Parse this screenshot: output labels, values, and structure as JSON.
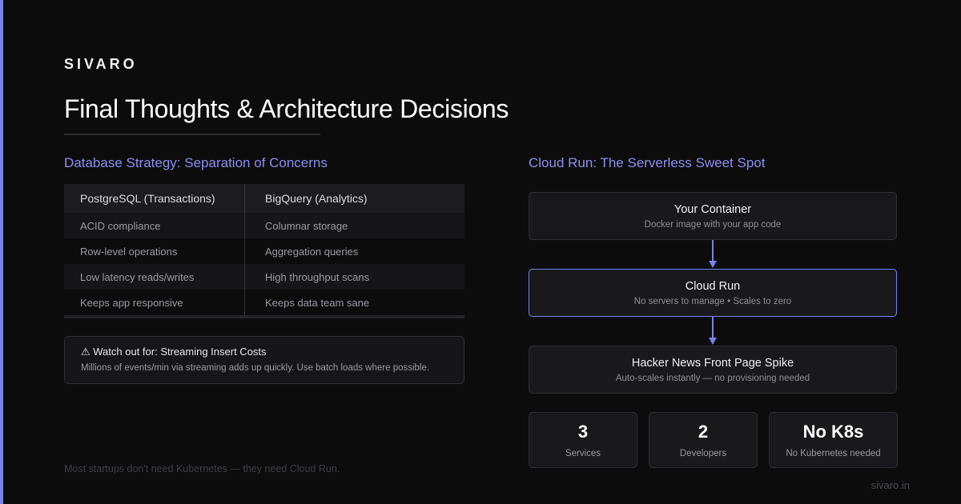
{
  "brand": "SIVARO",
  "title": "Final Thoughts & Architecture Decisions",
  "database": {
    "heading": "Database Strategy: Separation of Concerns",
    "columns": [
      "PostgreSQL (Transactions)",
      "BigQuery (Analytics)"
    ],
    "rows": [
      [
        "ACID compliance",
        "Columnar storage"
      ],
      [
        "Row-level operations",
        "Aggregation queries"
      ],
      [
        "Low latency reads/writes",
        "High throughput scans"
      ],
      [
        "Keeps app responsive",
        "Keeps data team sane"
      ]
    ]
  },
  "warning": {
    "icon": "warning-icon",
    "title": "⚠ Watch out for: Streaming Insert Costs",
    "text": "Millions of events/min via streaming adds up quickly. Use batch loads where possible."
  },
  "tagline": "Most startups don't need Kubernetes — they need Cloud Run.",
  "cloud_run": {
    "heading": "Cloud Run: The Serverless Sweet Spot",
    "flow": [
      {
        "title": "Your Container",
        "subtitle": "Docker image with your app code"
      },
      {
        "title": "Cloud Run",
        "subtitle": "No servers to manage • Scales to zero"
      },
      {
        "title": "Hacker News Front Page Spike",
        "subtitle": "Auto-scales instantly — no provisioning needed"
      }
    ],
    "stats": [
      {
        "value": "3",
        "label": "Services"
      },
      {
        "value": "2",
        "label": "Developers"
      },
      {
        "value": "No K8s",
        "label": "No Kubernetes needed"
      }
    ]
  },
  "footer_url": "sivaro.in",
  "colors": {
    "accent": "#7b83e8",
    "background": "#0c0c0d",
    "heading": "#8a90f0"
  }
}
